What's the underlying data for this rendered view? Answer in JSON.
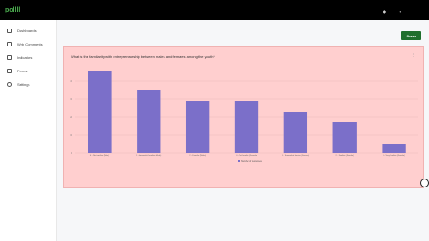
{
  "app": {
    "logo_text": "pollll"
  },
  "topbar_icons": [
    "bell-icon",
    "user-icon"
  ],
  "sidebar": {
    "items": [
      {
        "label": "Dashboards",
        "icon": "dashboard-icon"
      },
      {
        "label": "Web Comments",
        "icon": "comments-icon"
      },
      {
        "label": "Indicators",
        "icon": "indicators-icon"
      },
      {
        "label": "Forms",
        "icon": "forms-icon"
      },
      {
        "label": "Settings",
        "icon": "gear-icon"
      }
    ]
  },
  "main": {
    "share_label": "Share"
  },
  "card": {
    "title": "What is the familiarity with entrepreneurship between males and females among the youth?",
    "menu": "⋮"
  },
  "colors": {
    "bar": "#7b6fc9",
    "card_bg": "#ffcfcf",
    "share_button": "#1f6f2d"
  },
  "chart_data": {
    "type": "bar",
    "categories": [
      "0 - Not familiar (Male)",
      "1 - Somewhat familiar (Male)",
      "2 - Familiar (Male)",
      "0 - Not familiar (Female)",
      "1 - Somewhat familiar (Female)",
      "2 - Familiar (Female)",
      "3 - Very familiar (Female)"
    ],
    "series": [
      {
        "name": "Number of responses",
        "values": [
          46,
          35,
          29,
          29,
          23,
          17,
          5
        ]
      }
    ],
    "ylim": [
      0,
      50
    ],
    "yticks": [
      0,
      10,
      20,
      30,
      40
    ],
    "grid": true,
    "legend_position": "bottom-center"
  }
}
